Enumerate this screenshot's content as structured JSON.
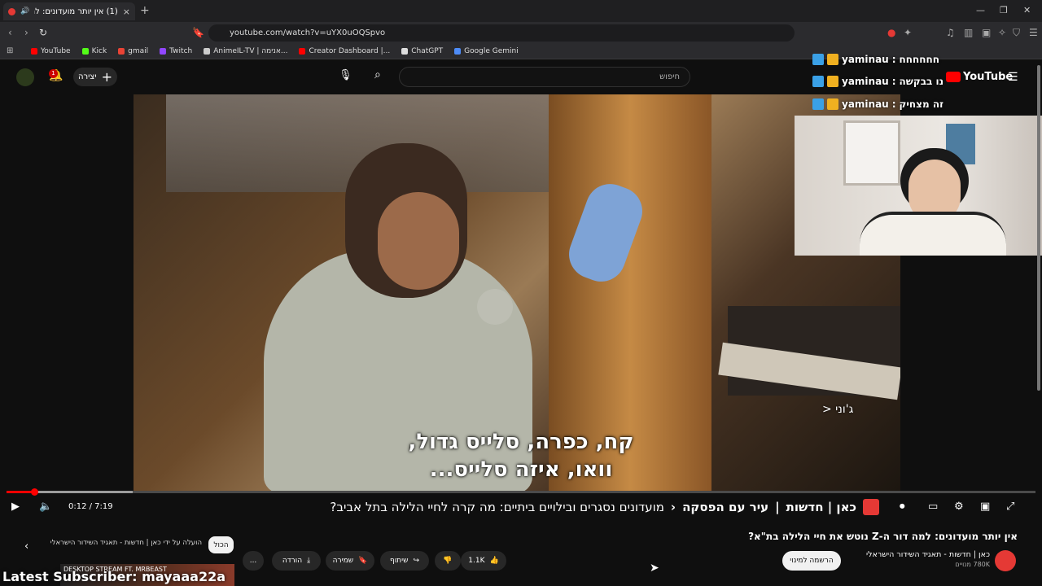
{
  "browser": {
    "tab_title": "(1) אין יותר מועדונים: למה דור",
    "tab_close": "×",
    "new_tab": "+",
    "url": "youtube.com/watch?v=uYX0uOQSpvo",
    "window_controls": [
      "—",
      "❐",
      "✕"
    ],
    "bookmarks": [
      {
        "label": "YouTube",
        "color": "#ff0000"
      },
      {
        "label": "Kick",
        "color": "#53fc18"
      },
      {
        "label": "gmail",
        "color": "#ea4335"
      },
      {
        "label": "Twitch",
        "color": "#9146ff"
      },
      {
        "label": "AnimeIL-TV | אנימה...",
        "color": "#cccccc"
      },
      {
        "label": "Creator Dashboard |...",
        "color": "#ff0000"
      },
      {
        "label": "ChatGPT",
        "color": "#dddddd"
      },
      {
        "label": "Google Gemini",
        "color": "#4e8cf7"
      }
    ]
  },
  "masthead": {
    "create_label": "יצירה",
    "search_placeholder": "חיפוש",
    "notification_count": "1"
  },
  "video": {
    "subtitle_line1": "קח, כפרה, סלייס גדול,",
    "subtitle_line2": "וואו, איזה סלייס...",
    "speaker_tag": "ג'וני <",
    "current_time": "0:12 / 7:19",
    "progress": 0.027,
    "chapter_brand": "כאן | חדשות",
    "chapter_show": "עיר עם הפסקה",
    "chapter_title": "מועדונים נסגרים ובילויים ביתיים: מה קרה לחיי הלילה בתל אביב?"
  },
  "below": {
    "title": "אין יותר מועדונים: למה דור ה-Z נוטש את חיי הלילה בת\"א?",
    "channel_name": "כאן | חדשות - תאגיד השידור הישראלי",
    "subscribers": "780K מנויים",
    "subscribe_label": "הרשמה למינוי",
    "like_count": "1.1K",
    "share_label": "שיתוף",
    "save_label": "שמירה",
    "download_label": "הורדה",
    "more_label": "...",
    "chip_all": "הכול",
    "chip_uploaded": "הועלה על ידי כאן | חדשות - תאגיד השידור הישראלי"
  },
  "overlay": {
    "chat": [
      {
        "user": "yaminau",
        "message": "חחחחחח"
      },
      {
        "user": "yaminau",
        "message": "נו בבקשה"
      },
      {
        "user": "yaminau",
        "message": "זה מצחיק"
      }
    ],
    "youtube_logo": "YouTube",
    "latest_subscriber": "Latest Subscriber: mayaaa22a",
    "desktop_stream": "DESKTOP STREAM FT. MRBEAST"
  },
  "colors": {
    "accent": "#ff0000",
    "background": "#0f0f0f",
    "kan_red": "#e53935"
  }
}
